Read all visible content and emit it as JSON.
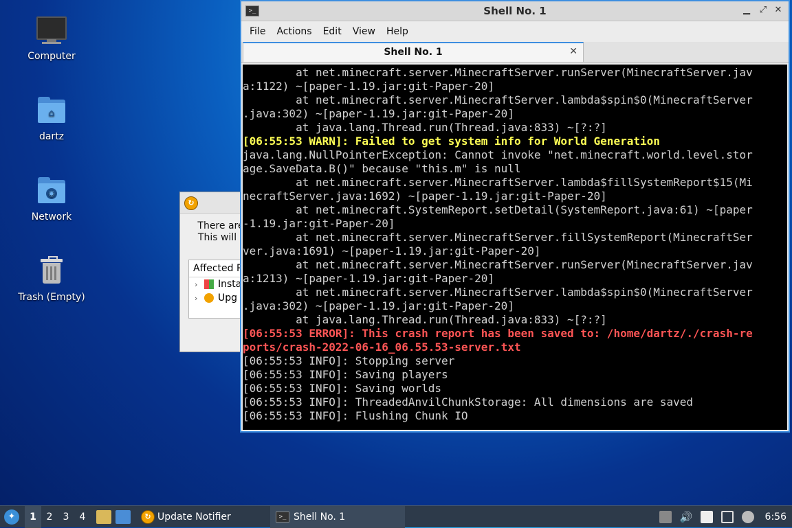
{
  "desktop": {
    "icons": [
      {
        "label": "Computer"
      },
      {
        "label": "dartz"
      },
      {
        "label": "Network"
      },
      {
        "label": "Trash (Empty)"
      }
    ]
  },
  "update_dialog": {
    "message_line1": "There are",
    "message_line2": "This will",
    "affected_header": "Affected P",
    "rows": [
      {
        "label": "Insta"
      },
      {
        "label": "Upg"
      }
    ]
  },
  "terminal": {
    "window_title": "Shell No. 1",
    "menu": [
      "File",
      "Actions",
      "Edit",
      "View",
      "Help"
    ],
    "tab_label": "Shell No. 1",
    "lines": [
      {
        "text": "        at net.minecraft.server.MinecraftServer.runServer(MinecraftServer.jav",
        "style": "normal"
      },
      {
        "text": "a:1122) ~[paper-1.19.jar:git-Paper-20]",
        "style": "normal"
      },
      {
        "text": "        at net.minecraft.server.MinecraftServer.lambda$spin$0(MinecraftServer",
        "style": "normal"
      },
      {
        "text": ".java:302) ~[paper-1.19.jar:git-Paper-20]",
        "style": "normal"
      },
      {
        "text": "        at java.lang.Thread.run(Thread.java:833) ~[?:?]",
        "style": "normal"
      },
      {
        "text": "[06:55:53 WARN]: Failed to get system info for World Generation",
        "style": "warn"
      },
      {
        "text": "java.lang.NullPointerException: Cannot invoke \"net.minecraft.world.level.stor",
        "style": "normal"
      },
      {
        "text": "age.SaveData.B()\" because \"this.m\" is null",
        "style": "normal"
      },
      {
        "text": "        at net.minecraft.server.MinecraftServer.lambda$fillSystemReport$15(Mi",
        "style": "normal"
      },
      {
        "text": "necraftServer.java:1692) ~[paper-1.19.jar:git-Paper-20]",
        "style": "normal"
      },
      {
        "text": "        at net.minecraft.SystemReport.setDetail(SystemReport.java:61) ~[paper",
        "style": "normal"
      },
      {
        "text": "-1.19.jar:git-Paper-20]",
        "style": "normal"
      },
      {
        "text": "        at net.minecraft.server.MinecraftServer.fillSystemReport(MinecraftSer",
        "style": "normal"
      },
      {
        "text": "ver.java:1691) ~[paper-1.19.jar:git-Paper-20]",
        "style": "normal"
      },
      {
        "text": "        at net.minecraft.server.MinecraftServer.runServer(MinecraftServer.jav",
        "style": "normal"
      },
      {
        "text": "a:1213) ~[paper-1.19.jar:git-Paper-20]",
        "style": "normal"
      },
      {
        "text": "        at net.minecraft.server.MinecraftServer.lambda$spin$0(MinecraftServer",
        "style": "normal"
      },
      {
        "text": ".java:302) ~[paper-1.19.jar:git-Paper-20]",
        "style": "normal"
      },
      {
        "text": "        at java.lang.Thread.run(Thread.java:833) ~[?:?]",
        "style": "normal"
      },
      {
        "text": "[06:55:53 ERROR]: This crash report has been saved to: /home/dartz/./crash-re",
        "style": "error"
      },
      {
        "text": "ports/crash-2022-06-16_06.55.53-server.txt",
        "style": "error"
      },
      {
        "text": "[06:55:53 INFO]: Stopping server",
        "style": "normal"
      },
      {
        "text": "[06:55:53 INFO]: Saving players",
        "style": "normal"
      },
      {
        "text": "[06:55:53 INFO]: Saving worlds",
        "style": "normal"
      },
      {
        "text": "[06:55:53 INFO]: ThreadedAnvilChunkStorage: All dimensions are saved",
        "style": "normal"
      },
      {
        "text": "[06:55:53 INFO]: Flushing Chunk IO",
        "style": "normal"
      }
    ]
  },
  "taskbar": {
    "workspaces": [
      "1",
      "2",
      "3",
      "4"
    ],
    "active_workspace": "1",
    "tasks": [
      {
        "label": "Update Notifier",
        "icon": "update-notifier-icon"
      },
      {
        "label": "Shell No. 1",
        "icon": "terminal-icon"
      }
    ],
    "clock": "6:56"
  },
  "colors": {
    "accent": "#3d8ee0",
    "warn": "#ffff55",
    "error": "#ff5555",
    "terminal_bg": "#000000",
    "taskbar_bg": "#2d3a4a"
  }
}
